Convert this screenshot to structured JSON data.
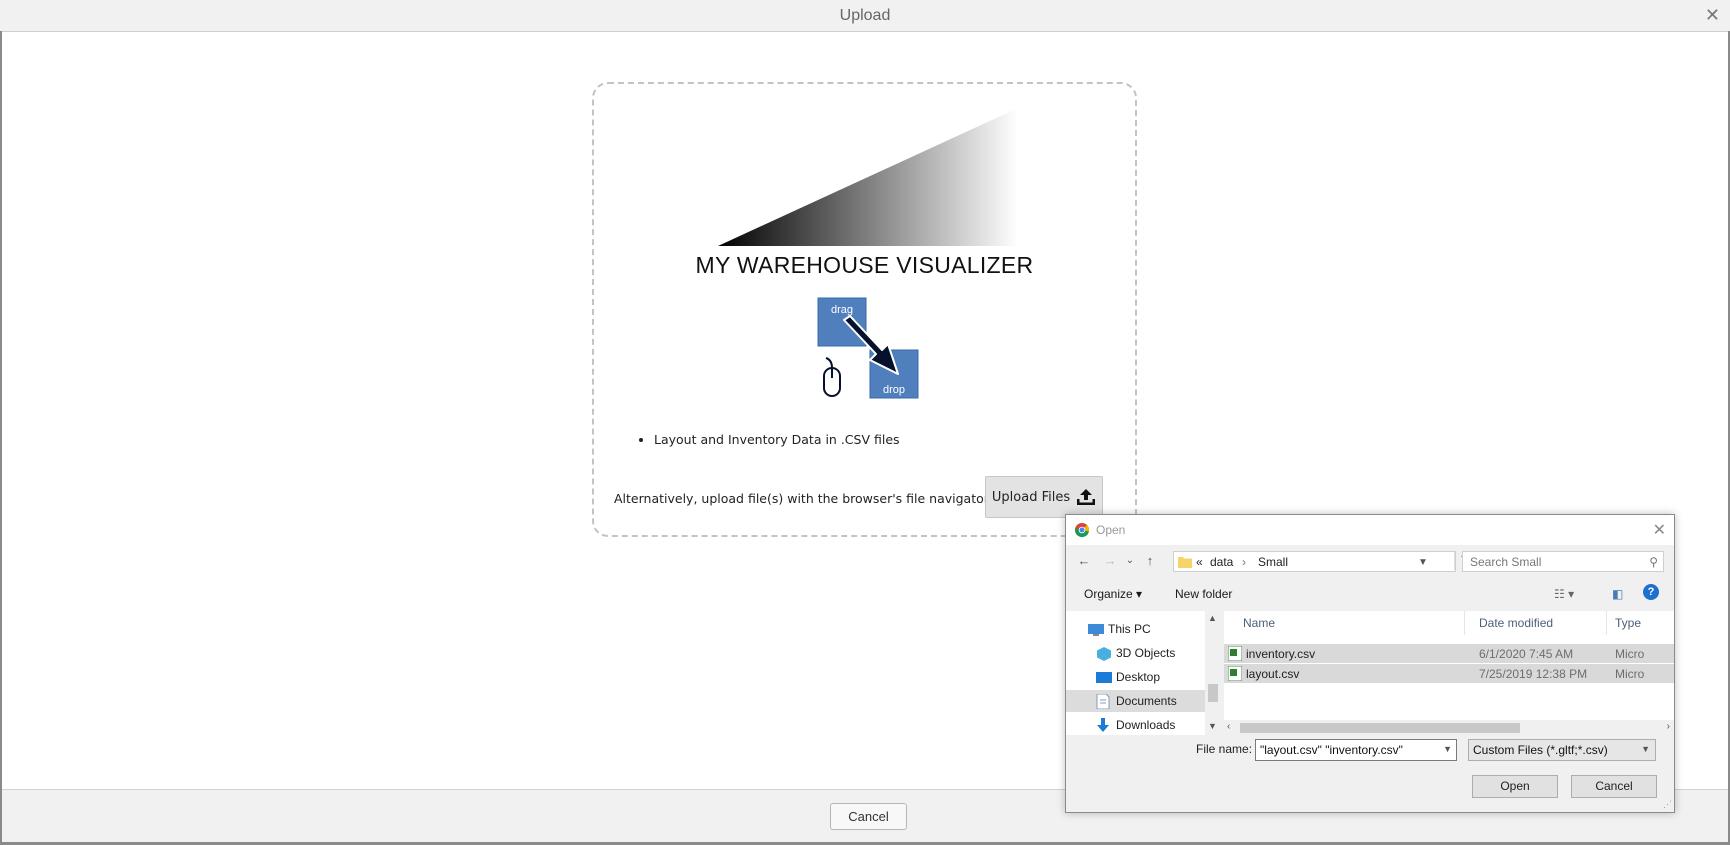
{
  "modal": {
    "title": "Upload",
    "close_glyph": "✕",
    "cancel_label": "Cancel"
  },
  "dropzone": {
    "title": "MY WAREHOUSE VISUALIZER",
    "drag_label": "drag",
    "drop_label": "drop",
    "bullets": [
      "Layout and Inventory Data in .CSV files"
    ],
    "alt_text": "Alternatively, upload file(s) with the browser's file navigator:",
    "upload_button_label": "Upload Files",
    "upload_icon": "upload-icon"
  },
  "dialog": {
    "title": "Open",
    "close_glyph": "✕",
    "nav": {
      "back": "←",
      "forward": "→",
      "recent": "⌄",
      "up": "↑"
    },
    "address": {
      "prefix": "«",
      "segments": [
        "data",
        "Small"
      ],
      "separator": "›"
    },
    "search_placeholder": "Search Small",
    "toolbar": {
      "organize": "Organize ▾",
      "new_folder": "New folder"
    },
    "nav_pane": [
      {
        "label": "This PC",
        "icon": "computer-icon"
      },
      {
        "label": "3D Objects",
        "icon": "cube-icon"
      },
      {
        "label": "Desktop",
        "icon": "desktop-icon"
      },
      {
        "label": "Documents",
        "icon": "document-icon",
        "selected": true
      },
      {
        "label": "Downloads",
        "icon": "download-icon"
      }
    ],
    "columns": [
      "Name",
      "Date modified",
      "Type"
    ],
    "files": [
      {
        "name": "inventory.csv",
        "modified": "6/1/2020 7:45 AM",
        "type": "Micro"
      },
      {
        "name": "layout.csv",
        "modified": "7/25/2019 12:38 PM",
        "type": "Micro"
      }
    ],
    "file_name_label": "File name:",
    "file_name_value": "\"layout.csv\" \"inventory.csv\"",
    "file_type_value": "Custom Files (*.gltf;*.csv)",
    "open_label": "Open",
    "cancel_label": "Cancel"
  }
}
